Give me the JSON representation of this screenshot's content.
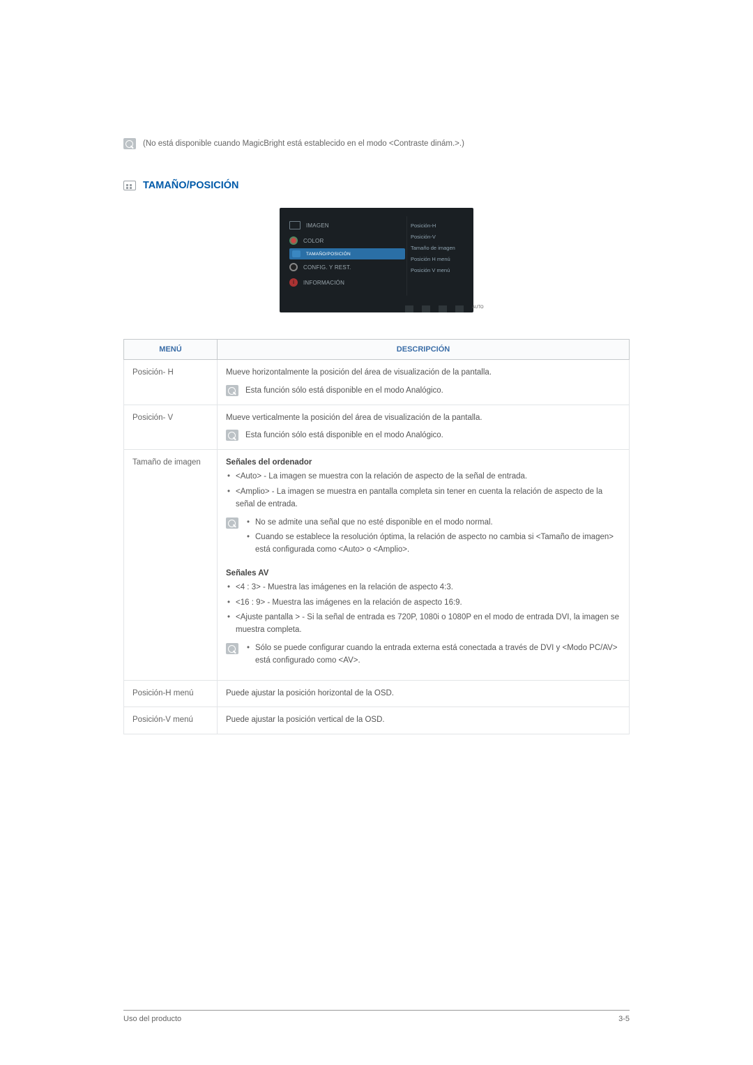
{
  "top_note": "(No está disponible cuando MagicBright está establecido en el modo <Contraste dinám.>.)",
  "section_heading": "TAMAÑO/POSICIÓN",
  "osd": {
    "left": {
      "items": [
        "IMAGEN",
        "COLOR",
        "TAMAÑO/POSICIÓN",
        "CONFIG. Y REST.",
        "INFORMACIÓN"
      ],
      "selected_index": 2
    },
    "right": [
      "Posición-H",
      "Posición-V",
      "Tamaño de imagen",
      "Posición H menú",
      "Posición V menú"
    ]
  },
  "table": {
    "headers": {
      "menu": "MENÚ",
      "desc": "DESCRIPCIÓN"
    },
    "rows": {
      "pos_h": {
        "menu": "Posición- H",
        "line1": "Mueve horizontalmente la posición del área de visualización de la pantalla.",
        "note": "Esta función sólo está disponible en el modo Analógico."
      },
      "pos_v": {
        "menu": "Posición- V",
        "line1": "Mueve verticalmente la posición del área de visualización de la pantalla.",
        "note": "Esta función sólo está disponible en el modo Analógico."
      },
      "tamano": {
        "menu": "Tamaño de imagen",
        "h1": "Señales del ordenador",
        "b1": "<Auto> - La imagen se muestra con la relación de aspecto de la señal de entrada.",
        "b2": "<Amplio> - La imagen se muestra en pantalla completa sin tener en cuenta la relación de aspecto de la señal de entrada.",
        "note1_b1": "No se admite una señal que no esté disponible en el modo normal.",
        "note1_b2": "Cuando se establece la resolución óptima, la relación de aspecto no cambia si <Tamaño de imagen> está configurada como <Auto> o <Amplio>.",
        "h2": "Señales AV",
        "c1": "<4 : 3> - Muestra las imágenes en la relación de aspecto 4:3.",
        "c2": "<16 : 9> - Muestra las imágenes en la relación de aspecto 16:9.",
        "c3": "<Ajuste pantalla > - Si la señal de entrada es 720P, 1080i o 1080P en el modo de entrada DVI, la imagen se muestra completa.",
        "note2": "Sólo se puede configurar cuando la entrada externa está conectada a través de DVI y <Modo PC/AV> está configurado como <AV>."
      },
      "posh_menu": {
        "menu": "Posición-H menú",
        "line1": "Puede ajustar la posición horizontal de la OSD."
      },
      "posv_menu": {
        "menu": "Posición-V menú",
        "line1": "Puede ajustar la posición vertical de la OSD."
      }
    }
  },
  "footer": {
    "left": "Uso del producto",
    "right": "3-5"
  }
}
